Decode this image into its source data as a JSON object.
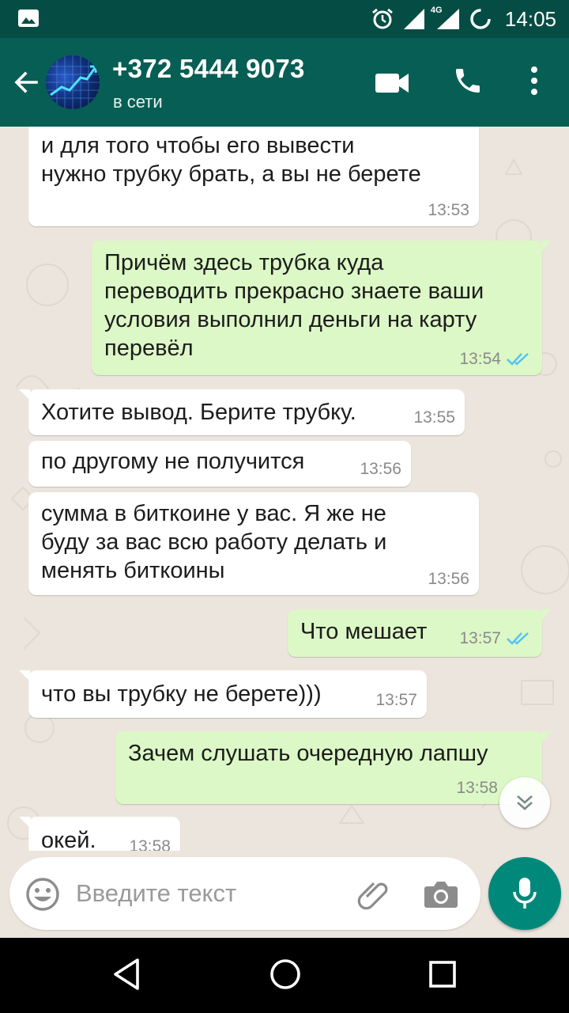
{
  "status_bar": {
    "time": "14:05",
    "network": "4G"
  },
  "header": {
    "contact_name": "+372 5444 9073",
    "contact_status": "в сети"
  },
  "messages": [
    {
      "direction": "in",
      "text": "и для того чтобы его вывести\nнужно трубку брать, а вы не берете",
      "time": "13:53"
    },
    {
      "direction": "out",
      "text": "Причём здесь трубка куда\nпереводить прекрасно знаете ваши\nусловия выполнил деньги на карту\nперевёл",
      "time": "13:54"
    },
    {
      "direction": "in",
      "text": "Хотите вывод. Берите трубку.",
      "time": "13:55"
    },
    {
      "direction": "in",
      "text": "по другому не получится",
      "time": "13:56"
    },
    {
      "direction": "in",
      "text": "сумма в биткоине у вас. Я же не\nбуду за вас всю работу делать и\nменять биткоины",
      "time": "13:56"
    },
    {
      "direction": "out",
      "text": "Что мешает",
      "time": "13:57"
    },
    {
      "direction": "in",
      "text": "что вы трубку не берете)))",
      "time": "13:57"
    },
    {
      "direction": "out",
      "text": "Зачем слушать очередную лапшу",
      "time": "13:58"
    },
    {
      "direction": "in",
      "text": "окей.",
      "time": "13:58"
    }
  ],
  "composer": {
    "placeholder": "Введите текст"
  },
  "colors": {
    "status_bar": "#054d44",
    "app_bar": "#075e54",
    "chat_background": "#ece5dd",
    "incoming_bubble": "#ffffff",
    "outgoing_bubble": "#dcf8c6",
    "read_ticks": "#4fc3f7",
    "mic_button": "#00897b"
  },
  "icons": {
    "status_left": "image-notification-icon",
    "alarm": "alarm-icon",
    "signal": "signal-icon",
    "sync": "sync-icon",
    "back": "arrow-back-icon",
    "video": "videocam-icon",
    "call": "phone-icon",
    "menu": "more-vert-icon",
    "scroll": "chevron-double-down-icon",
    "emoji": "emoji-icon",
    "attach": "paperclip-icon",
    "camera": "camera-icon",
    "mic": "mic-icon",
    "nav_back": "nav-back-icon",
    "nav_home": "nav-home-icon",
    "nav_recents": "nav-recents-icon"
  }
}
